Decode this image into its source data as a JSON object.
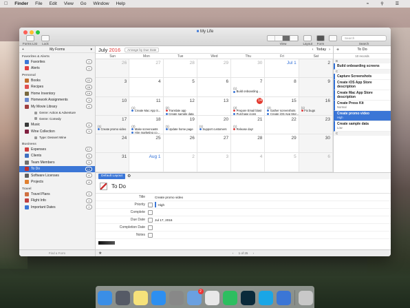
{
  "menubar": {
    "apple": "",
    "items": [
      "Finder",
      "File",
      "Edit",
      "View",
      "Go",
      "Window",
      "Help"
    ],
    "clock": "",
    "right_icons": [
      "wifi-icon",
      "search-icon",
      "menu-icon"
    ]
  },
  "window": {
    "title": "My Life",
    "toolbar_left": [
      {
        "label": "Forms List"
      },
      {
        "label": "Lock"
      }
    ],
    "toolbar_right": {
      "view_label": "View",
      "layout_label": "Layout",
      "form_label": "Form",
      "search_label": "Search",
      "search_placeholder": "Search"
    }
  },
  "sidebar": {
    "header": "My Forms",
    "sections": [
      {
        "title": "Favorites & Alerts",
        "items": [
          {
            "label": "Favorites",
            "count": "0",
            "color": "#3b76d6"
          },
          {
            "label": "Alerts",
            "count": "0",
            "color": "#e04040"
          }
        ]
      },
      {
        "title": "Personal",
        "items": [
          {
            "label": "Books",
            "count": "22",
            "color": "#c07030"
          },
          {
            "label": "Recipes",
            "count": "28",
            "color": "#e05050"
          },
          {
            "label": "Home Inventory",
            "count": "18",
            "color": "#7a6a40"
          },
          {
            "label": "Homework Assignments",
            "count": "9",
            "color": "#6a8ad0"
          },
          {
            "label": "My Movie Library",
            "count": "6",
            "color": "#a04040",
            "sub": [
              "Genre: Action & Adventure",
              "Genre: Comedy"
            ]
          },
          {
            "label": "Music",
            "count": "6",
            "color": "#3a3a3a"
          },
          {
            "label": "Wine Collection",
            "count": "9",
            "color": "#802040",
            "sub": [
              "Type: Dessert Wine"
            ]
          }
        ]
      },
      {
        "title": "Business",
        "items": [
          {
            "label": "Expenses",
            "count": "17",
            "color": "#d04040"
          },
          {
            "label": "Clients",
            "count": "5",
            "color": "#4070c0"
          },
          {
            "label": "Team Members",
            "count": "5",
            "color": "#707070"
          },
          {
            "label": "To Do",
            "count": "10",
            "color": "#c03030",
            "selected": true
          },
          {
            "label": "Software Licenses",
            "count": "6",
            "color": "#606060"
          },
          {
            "label": "Projects",
            "count": "8",
            "color": "#e08030"
          }
        ]
      },
      {
        "title": "Travel",
        "items": [
          {
            "label": "Travel Plans",
            "count": "0",
            "color": "#d07040"
          },
          {
            "label": "Flight Info",
            "count": "0",
            "color": "#c04040"
          },
          {
            "label": "Important Dates",
            "count": "0",
            "color": "#3b76d6"
          }
        ]
      }
    ],
    "footer": "Find a Form"
  },
  "calendar": {
    "month": "July",
    "year": "2016",
    "arrange": "Arrange by Due Date",
    "today_label": "Today",
    "days": [
      "Sun",
      "Mon",
      "Tue",
      "Wed",
      "Thu",
      "Fri",
      "Sat"
    ],
    "weeks": [
      [
        {
          "n": "26",
          "m": 1
        },
        {
          "n": "27",
          "m": 1
        },
        {
          "n": "28",
          "m": 1
        },
        {
          "n": "29",
          "m": 1
        },
        {
          "n": "30",
          "m": 1
        },
        {
          "n": "Jul 1",
          "b": 1
        },
        {
          "n": "2"
        }
      ],
      [
        {
          "n": "3"
        },
        {
          "n": "4"
        },
        {
          "n": "5"
        },
        {
          "n": "6"
        },
        {
          "n": "7",
          "c": "(1)",
          "ev": [
            {
              "t": "Build onboarding ...",
              "c": "#3b76d6"
            }
          ]
        },
        {
          "n": "8"
        },
        {
          "n": "9"
        }
      ],
      [
        {
          "n": "10"
        },
        {
          "n": "11",
          "c": "(1)",
          "ev": [
            {
              "t": "Create Mac App S...",
              "c": "#3b76d6"
            }
          ]
        },
        {
          "n": "12",
          "c": "(2)",
          "ev": [
            {
              "t": "Translate app",
              "c": "#e04040"
            },
            {
              "t": "Create sample data",
              "c": "#3b76d6"
            }
          ]
        },
        {
          "n": "13"
        },
        {
          "n": "14",
          "c": "(2)",
          "t": 1,
          "ev": [
            {
              "t": "Prepare Email blast",
              "c": "#e04040"
            },
            {
              "t": "Purchase icons",
              "c": "#3b76d6"
            }
          ]
        },
        {
          "n": "15",
          "c": "(2)",
          "ev": [
            {
              "t": "Gather screenshots",
              "c": "#3b76d6"
            },
            {
              "t": "Create iOS App Stor...",
              "c": "#3b76d6"
            }
          ]
        },
        {
          "n": "16",
          "c": "(1)",
          "ev": [
            {
              "t": "Fix bugs",
              "c": "#e04040"
            }
          ]
        }
      ],
      [
        {
          "n": "17",
          "c": "(1)",
          "ev": [
            {
              "t": "Create promo video",
              "c": "#3b76d6"
            }
          ]
        },
        {
          "n": "18",
          "c": "(2)",
          "ev": [
            {
              "t": "Make screencasts",
              "c": "#3b76d6"
            },
            {
              "t": "Hire marketing co...",
              "c": "#3b76d6"
            }
          ]
        },
        {
          "n": "19",
          "c": "(1)",
          "ev": [
            {
              "t": "Update home page",
              "c": "#3b76d6"
            }
          ]
        },
        {
          "n": "20",
          "c": "(1)",
          "ev": [
            {
              "t": "Support customers",
              "c": "#3b76d6"
            }
          ]
        },
        {
          "n": "21",
          "c": "(1)",
          "ev": [
            {
              "t": "Release day!",
              "c": "#e04040"
            }
          ]
        },
        {
          "n": "22"
        },
        {
          "n": "23"
        }
      ],
      [
        {
          "n": "24"
        },
        {
          "n": "25"
        },
        {
          "n": "26"
        },
        {
          "n": "27"
        },
        {
          "n": "28"
        },
        {
          "n": "29"
        },
        {
          "n": "30"
        }
      ],
      [
        {
          "n": "31"
        },
        {
          "n": "Aug 1",
          "b": 1
        },
        {
          "n": "2",
          "m": 1
        },
        {
          "n": "3",
          "m": 1
        },
        {
          "n": "4",
          "m": 1
        },
        {
          "n": "5",
          "m": 1
        },
        {
          "n": "6",
          "m": 1
        }
      ]
    ]
  },
  "todo_panel": {
    "title": "To Do",
    "record_count": "10 records",
    "groups": [
      {
        "letter": "B",
        "items": [
          {
            "title": "Build onboarding screens",
            "sub": ""
          }
        ]
      },
      {
        "letter": "C",
        "items": [
          {
            "title": "Capture Screenshots",
            "sub": ""
          },
          {
            "title": "Create iOS App Store description",
            "sub": ""
          },
          {
            "title": "Create Mac App Store description",
            "sub": ""
          },
          {
            "title": "Create Press Kit",
            "sub": "Normal"
          },
          {
            "title": "Create promo video",
            "sub": "High",
            "selected": true
          },
          {
            "title": "Create sample data",
            "sub": "Low"
          }
        ]
      },
      {
        "letter": "C",
        "items": []
      }
    ]
  },
  "detail": {
    "layout_tab": "Default Layout",
    "form_title": "To Do",
    "fields": [
      {
        "label": "Title",
        "value": "Create promo video",
        "icon": ""
      },
      {
        "label": "Priority",
        "value": "High",
        "icon": "list-icon"
      },
      {
        "label": "Complete",
        "value": "",
        "icon": "checkbox-icon"
      },
      {
        "label": "Due Date",
        "value": "Jul 17, 2016",
        "icon": "calendar-icon"
      },
      {
        "label": "Completion Date",
        "value": "",
        "icon": "calendar-icon"
      },
      {
        "label": "Notes",
        "value": "",
        "icon": "note-icon"
      }
    ],
    "record_position": "1 of 25"
  },
  "dock": {
    "apps": [
      {
        "name": "finder",
        "color": "#3a8ee6"
      },
      {
        "name": "launchpad",
        "color": "#555a66"
      },
      {
        "name": "notes",
        "color": "#f6e27a"
      },
      {
        "name": "app-store",
        "color": "#2d8ff0"
      },
      {
        "name": "system-preferences",
        "color": "#888"
      },
      {
        "name": "mail",
        "color": "#6aa0e0",
        "badge": "2"
      },
      {
        "name": "chrome",
        "color": "#e8e8e8"
      },
      {
        "name": "evernote",
        "color": "#2dbe60"
      },
      {
        "name": "photoshop",
        "color": "#0a2a3a"
      },
      {
        "name": "skype",
        "color": "#1aa6e6"
      },
      {
        "name": "tap-forms",
        "color": "#3b76d6"
      },
      {
        "name": "trash",
        "color": "#c8c8c8"
      }
    ]
  }
}
